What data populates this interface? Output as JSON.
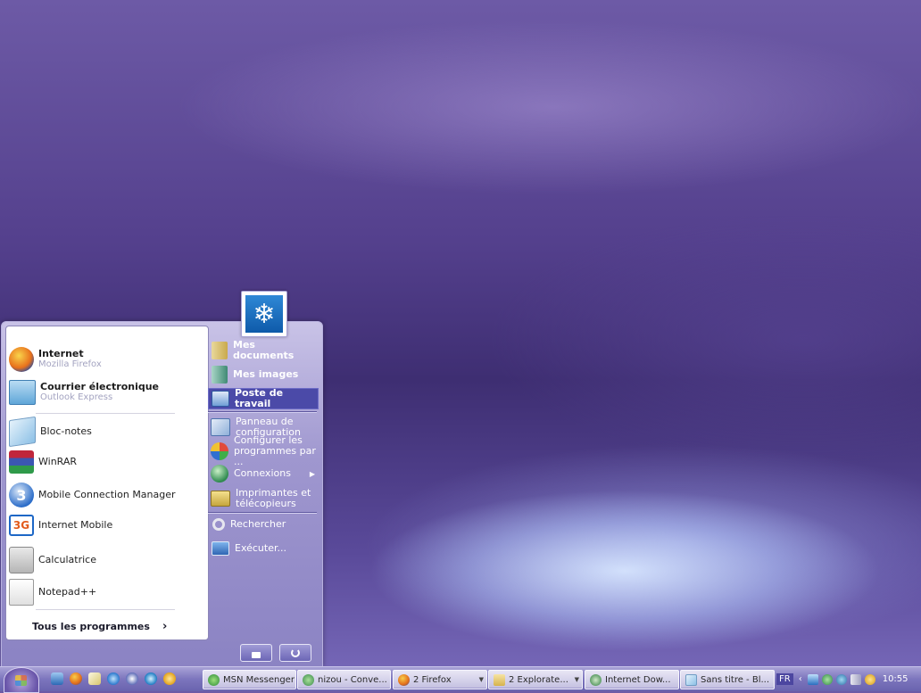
{
  "start_menu": {
    "pinned": [
      {
        "title": "Internet",
        "subtitle": "Mozilla Firefox"
      },
      {
        "title": "Courrier électronique",
        "subtitle": "Outlook Express"
      }
    ],
    "recent": [
      {
        "label": "Bloc-notes"
      },
      {
        "label": "WinRAR"
      },
      {
        "label": "Mobile Connection Manager"
      },
      {
        "label": "Internet Mobile"
      },
      {
        "label": "Calculatrice"
      },
      {
        "label": "Notepad++"
      }
    ],
    "all_programs": "Tous les programmes",
    "right": {
      "mes_documents": "Mes documents",
      "mes_images": "Mes images",
      "poste_de_travail": "Poste de travail",
      "panneau_l1": "Panneau de",
      "panneau_l2": "configuration",
      "configurer_l1": "Configurer les",
      "configurer_l2": "programmes par ...",
      "connexions": "Connexions",
      "imprimantes_l1": "Imprimantes et",
      "imprimantes_l2": "télécopieurs",
      "rechercher": "Rechercher",
      "executer": "Exécuter..."
    },
    "icons": {
      "user": "snowflake-icon",
      "lock": "lock-icon",
      "power": "power-icon"
    }
  },
  "taskbar": {
    "buttons": [
      {
        "label": "MSN Messenger"
      },
      {
        "label": "nizou - Conve..."
      },
      {
        "label": "2 Firefox"
      },
      {
        "label": "2 Explorate..."
      },
      {
        "label": "Internet Dow..."
      },
      {
        "label": "Sans titre - Bl..."
      }
    ],
    "language": "FR",
    "clock": "10:55"
  },
  "colors": {
    "highlight": "#4b4aa8",
    "taskbar": "#7c75bd"
  }
}
